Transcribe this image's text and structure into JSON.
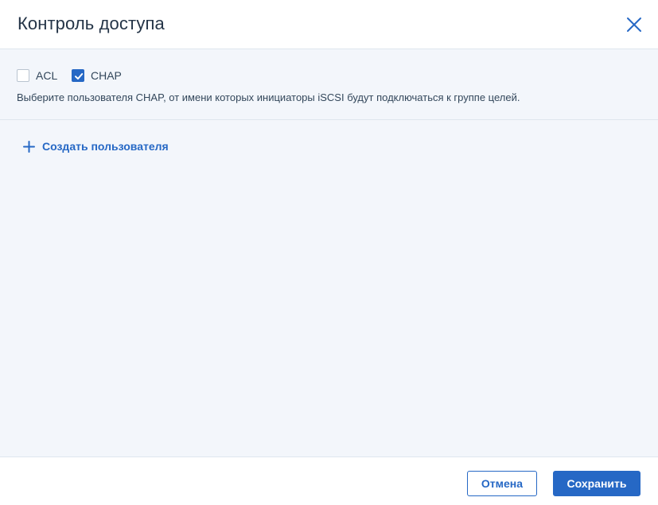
{
  "dialog": {
    "title": "Контроль доступа",
    "close_icon": "close-icon"
  },
  "options": {
    "checkboxes": [
      {
        "label": "ACL",
        "checked": false
      },
      {
        "label": "CHAP",
        "checked": true
      }
    ],
    "hint": "Выберите пользователя CHAP, от имени которых инициаторы iSCSI будут подключаться к группе целей."
  },
  "body": {
    "create_user_label": "Создать пользователя",
    "create_user_icon": "plus-icon"
  },
  "footer": {
    "cancel_label": "Отмена",
    "save_label": "Сохранить"
  },
  "colors": {
    "accent": "#2668c5",
    "text": "#243447",
    "panel_bg": "#f3f6fb",
    "border": "#dfe6ee"
  }
}
